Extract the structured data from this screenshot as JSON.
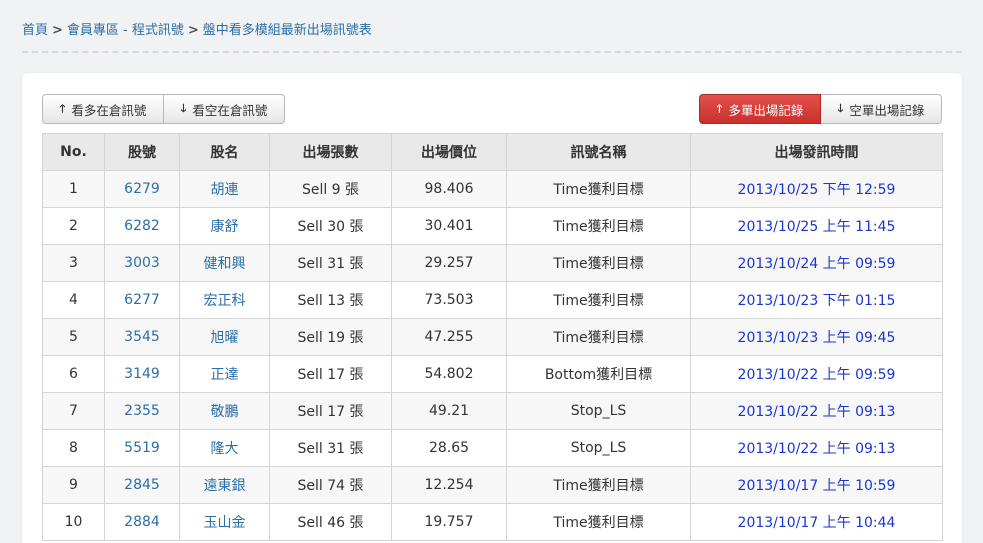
{
  "breadcrumb": [
    {
      "label": "首頁"
    },
    {
      "label": "會員專區 - 程式訊號"
    },
    {
      "label": "盤中看多模組最新出場訊號表"
    }
  ],
  "breadcrumb_separator": ">",
  "buttons": {
    "long_positions": "看多在倉訊號",
    "short_positions": "看空在倉訊號",
    "long_exits": "多單出場記錄",
    "short_exits": "空單出場記錄"
  },
  "icons": {
    "up": "arrow-up-icon",
    "down": "arrow-down-icon"
  },
  "colors": {
    "link": "#2a6fa8",
    "time": "#1a36d2",
    "active_button": "#d9423e",
    "header_bg": "#e9e9e9"
  },
  "table": {
    "headers": [
      "No.",
      "股號",
      "股名",
      "出場張數",
      "出場價位",
      "訊號名稱",
      "出場發訊時間"
    ],
    "rows": [
      [
        "1",
        "6279",
        "胡連",
        "Sell 9 張",
        "98.406",
        "Time獲利目標",
        "2013/10/25 下午 12:59"
      ],
      [
        "2",
        "6282",
        "康舒",
        "Sell 30 張",
        "30.401",
        "Time獲利目標",
        "2013/10/25 上午 11:45"
      ],
      [
        "3",
        "3003",
        "健和興",
        "Sell 31 張",
        "29.257",
        "Time獲利目標",
        "2013/10/24 上午 09:59"
      ],
      [
        "4",
        "6277",
        "宏正科",
        "Sell 13 張",
        "73.503",
        "Time獲利目標",
        "2013/10/23 下午 01:15"
      ],
      [
        "5",
        "3545",
        "旭曜",
        "Sell 19 張",
        "47.255",
        "Time獲利目標",
        "2013/10/23 上午 09:45"
      ],
      [
        "6",
        "3149",
        "正達",
        "Sell 17 張",
        "54.802",
        "Bottom獲利目標",
        "2013/10/22 上午 09:59"
      ],
      [
        "7",
        "2355",
        "敬鵬",
        "Sell 17 張",
        "49.21",
        "Stop_LS",
        "2013/10/22 上午 09:13"
      ],
      [
        "8",
        "5519",
        "隆大",
        "Sell 31 張",
        "28.65",
        "Stop_LS",
        "2013/10/22 上午 09:13"
      ],
      [
        "9",
        "2845",
        "遠東銀",
        "Sell 74 張",
        "12.254",
        "Time獲利目標",
        "2013/10/17 上午 10:59"
      ],
      [
        "10",
        "2884",
        "玉山金",
        "Sell 46 張",
        "19.757",
        "Time獲利目標",
        "2013/10/17 上午 10:44"
      ]
    ]
  }
}
